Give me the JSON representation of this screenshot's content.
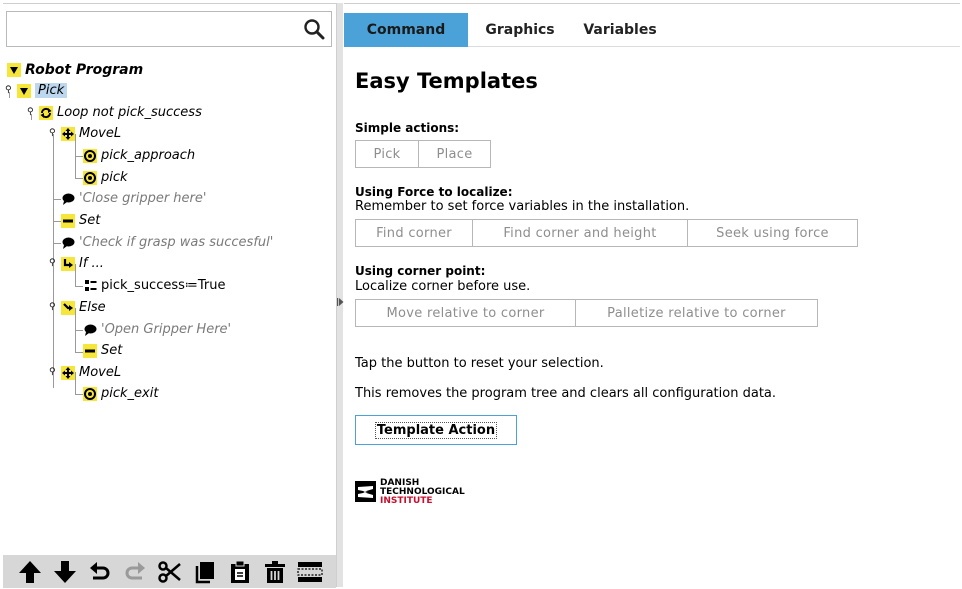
{
  "search": {
    "value": "",
    "placeholder": ""
  },
  "tree": {
    "items": [
      {
        "label": "Robot Program",
        "icon": "collapse-triangle-icon"
      },
      {
        "label": "Pick",
        "icon": "collapse-triangle-icon"
      },
      {
        "label": "Loop not pick_success",
        "icon": "loop-icon"
      },
      {
        "label": "MoveL",
        "icon": "move-icon"
      },
      {
        "label": "pick_approach",
        "icon": "waypoint-icon"
      },
      {
        "label": "pick",
        "icon": "waypoint-icon"
      },
      {
        "label": "'Close gripper here'",
        "icon": "comment-icon"
      },
      {
        "label": "Set",
        "icon": "set-icon"
      },
      {
        "label": "'Check if grasp was succesful'",
        "icon": "comment-icon"
      },
      {
        "label": "If ...",
        "icon": "if-icon"
      },
      {
        "label": "pick_success≔True",
        "icon": "assignment-icon"
      },
      {
        "label": "Else",
        "icon": "else-icon"
      },
      {
        "label": "'Open Gripper Here'",
        "icon": "comment-icon"
      },
      {
        "label": "Set",
        "icon": "set-icon"
      },
      {
        "label": "MoveL",
        "icon": "move-icon"
      },
      {
        "label": "pick_exit",
        "icon": "waypoint-icon"
      }
    ]
  },
  "toolbar": {
    "icons": [
      "arrow-up-icon",
      "arrow-down-icon",
      "undo-icon",
      "redo-icon",
      "cut-icon",
      "copy-icon",
      "paste-icon",
      "delete-icon",
      "suppress-icon"
    ]
  },
  "tabs": [
    {
      "label": "Command"
    },
    {
      "label": "Graphics"
    },
    {
      "label": "Variables"
    }
  ],
  "content": {
    "title": "Easy Templates",
    "simple_actions": {
      "title": "Simple actions:",
      "buttons": [
        "Pick",
        "Place"
      ]
    },
    "force": {
      "title": "Using Force to localize:",
      "subtitle": "Remember to set force variables in the installation.",
      "buttons": [
        "Find corner",
        "Find corner and height",
        "Seek using force"
      ]
    },
    "corner": {
      "title": "Using corner point:",
      "subtitle": "Localize corner before use.",
      "buttons": [
        "Move relative to corner",
        "Palletize relative to corner"
      ]
    },
    "reset_text_1": "Tap the button to reset your selection.",
    "reset_text_2": "This removes the program tree and clears all configuration data.",
    "template_action_label": "Template Action",
    "logo": {
      "line1": "DANISH",
      "line2": "TECHNOLOGICAL",
      "line3": "INSTITUTE"
    }
  },
  "colors": {
    "accent": "#4aa2d8",
    "node_yellow": "#f6e63a",
    "selection": "#bcd7ee",
    "logo_red": "#c8102e"
  }
}
